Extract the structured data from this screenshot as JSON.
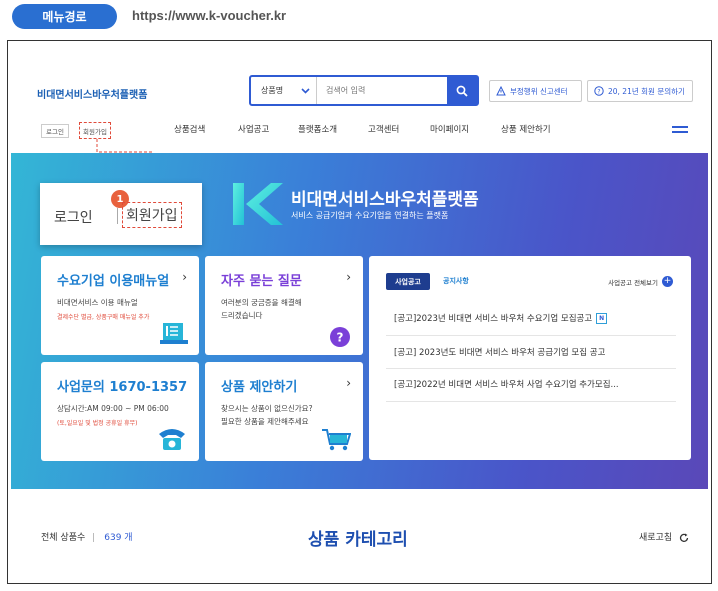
{
  "header": {
    "menu_path_label": "메뉴경로",
    "url": "https://www.k-voucher.kr"
  },
  "site": {
    "logo": "비대면서비스바우처플랫폼"
  },
  "search": {
    "category": "상품명",
    "placeholder": "검색어 입력"
  },
  "top_links": {
    "report": "부정행위 신고센터",
    "inquiry": "20, 21년 회원 문의하기"
  },
  "auth": {
    "login": "로그인",
    "join": "회원가입"
  },
  "nav": {
    "items": [
      "상품검색",
      "사업공고",
      "플랫폼소개",
      "고객센터",
      "마이페이지",
      "상품 제안하기"
    ]
  },
  "callout": {
    "login": "로그인",
    "join": "회원가입",
    "step": "1"
  },
  "hero": {
    "title": "비대면서비스바우처플랫폼",
    "subtitle": "서비스 공급기업과 수요기업을 연결하는 플랫폼"
  },
  "cards": {
    "manual": {
      "title": "수요기업 이용매뉴얼",
      "line1": "비대면서비스 이용 매뉴얼",
      "line2": "결제수단 별급, 상품구매 매뉴얼 추가"
    },
    "faq": {
      "title": "자주 묻는 질문",
      "line1": "여러분의 궁금증을 해결해",
      "line2": "드리겠습니다"
    },
    "contact": {
      "title_prefix": "사업문의 ",
      "phone": "1670-1357",
      "line1": "상담시간:AM 09:00 ~ PM 06:00",
      "line2": "(토,일요일 및 법정 공휴일 휴무)"
    },
    "propose": {
      "title": "상품 제안하기",
      "line1": "찾으시는 상품이 없으신가요?",
      "line2": "필요한 상품을 제안해주세요"
    }
  },
  "notice": {
    "tab_active": "사업공고",
    "tab_inactive": "공지사항",
    "view_all": "사업공고 전체보기",
    "new_badge": "N",
    "rows": [
      "[공고]2023년 비대면 서비스 바우처 수요기업 모집공고",
      "[공고] 2023년도 비대면 서비스 바우처 공급기업 모집 공고",
      "[공고]2022년 비대면 서비스 바우처 사업 수요기업 추가모집..."
    ]
  },
  "products": {
    "total_label": "전체 상품수",
    "total_count": "639 개",
    "category_title": "상품 카테고리",
    "refresh": "새로고침"
  },
  "colors": {
    "primary": "#2f5bd3",
    "navy": "#1e3d8f",
    "accent_red": "#e04a3a",
    "cyan": "#27c5d8",
    "purple": "#7a3fd8"
  }
}
